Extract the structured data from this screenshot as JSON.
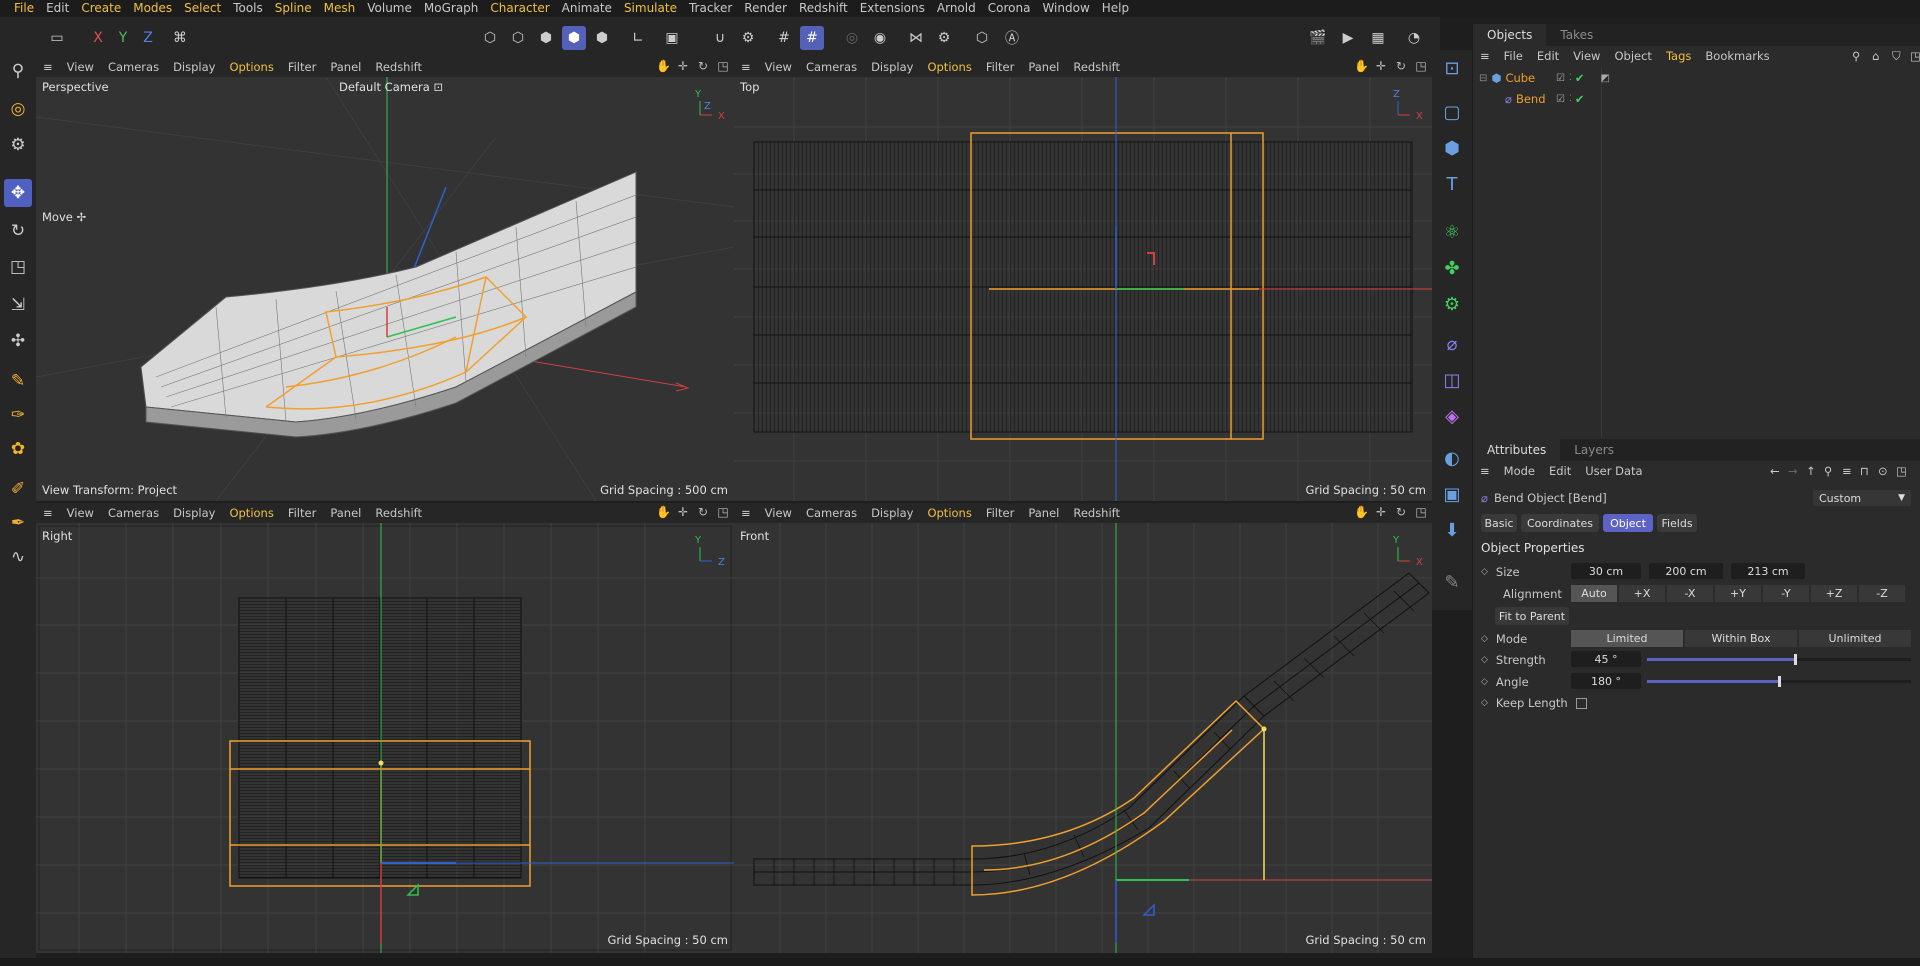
{
  "menu": [
    "File",
    "Edit",
    "Create",
    "Modes",
    "Select",
    "Tools",
    "Spline",
    "Mesh",
    "Volume",
    "MoGraph",
    "Character",
    "Animate",
    "Simulate",
    "Tracker",
    "Render",
    "Redshift",
    "Extensions",
    "Arnold",
    "Corona",
    "Window",
    "Help"
  ],
  "menu_highlight": [
    "File",
    "Create",
    "Modes",
    "Select",
    "Spline",
    "Mesh",
    "Character",
    "Simulate"
  ],
  "axis_buttons": [
    "X",
    "Y",
    "Z"
  ],
  "viewport_menu": [
    "View",
    "Cameras",
    "Display",
    "Options",
    "Filter",
    "Panel",
    "Redshift"
  ],
  "viewports": {
    "perspective": {
      "name": "Perspective",
      "camera": "Default Camera",
      "tool": "Move",
      "footer_left": "View Transform: Project",
      "grid": "Grid Spacing : 500 cm"
    },
    "top": {
      "name": "Top",
      "grid": "Grid Spacing : 50 cm"
    },
    "right": {
      "name": "Right",
      "grid": "Grid Spacing : 50 cm"
    },
    "front": {
      "name": "Front",
      "grid": "Grid Spacing : 50 cm"
    }
  },
  "axes": {
    "x": "X",
    "y": "Y",
    "z": "Z"
  },
  "objects_panel": {
    "tabs": [
      "Objects",
      "Takes"
    ],
    "menu": [
      "File",
      "Edit",
      "View",
      "Object",
      "Tags",
      "Bookmarks"
    ],
    "items": [
      {
        "name": "Cube",
        "color": "#f0a030"
      },
      {
        "name": "Bend",
        "color": "#f0a030"
      }
    ]
  },
  "attributes_panel": {
    "tabs": [
      "Attributes",
      "Layers"
    ],
    "menu": [
      "Mode",
      "Edit",
      "User Data"
    ],
    "object_title": "Bend Object [Bend]",
    "preset": "Custom",
    "section_tabs": [
      "Basic",
      "Coordinates",
      "Object",
      "Fields"
    ],
    "active_section": "Object",
    "section_title": "Object Properties",
    "size_label": "Size",
    "size": [
      "30 cm",
      "200 cm",
      "213 cm"
    ],
    "alignment_label": "Alignment",
    "alignment_options": [
      "Auto",
      "+X",
      "-X",
      "+Y",
      "-Y",
      "+Z",
      "-Z"
    ],
    "fit_button": "Fit to Parent",
    "mode_label": "Mode",
    "mode_options": [
      "Limited",
      "Within Box",
      "Unlimited"
    ],
    "strength_label": "Strength",
    "strength": "45 °",
    "strength_level": 0.56,
    "angle_label": "Angle",
    "angle": "180 °",
    "angle_level": 0.5,
    "keep_length_label": "Keep Length"
  },
  "colors": {
    "accent": "#5c63c4",
    "highlight": "#f0c040",
    "selection": "#f0a030",
    "x_axis": "#d04040",
    "y_axis": "#30c050",
    "z_axis": "#3060d0"
  }
}
